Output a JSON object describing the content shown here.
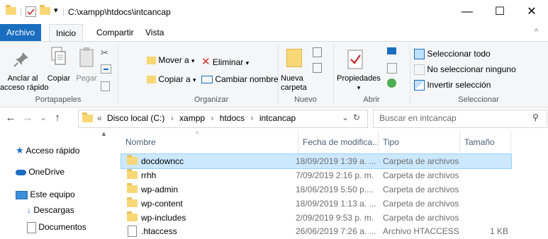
{
  "window": {
    "path_title": "C:\\xampp\\htdocs\\intcancap",
    "minimize_glyph": "—",
    "maximize_glyph": "☐",
    "close_glyph": "✕"
  },
  "ribbon_tabs": [
    "Archivo",
    "Inicio",
    "Compartir",
    "Vista"
  ],
  "ribbon_collapse_glyph": "^",
  "ribbon": {
    "portapapeles": {
      "label": "Portapapeles",
      "pin_label_1": "Anclar al",
      "pin_label_2": "acceso rápido",
      "copy_label": "Copiar",
      "paste_label": "Pegar"
    },
    "organizar": {
      "label": "Organizar",
      "move_to": "Mover a",
      "copy_to": "Copiar a",
      "delete": "Eliminar",
      "rename": "Cambiar nombre"
    },
    "nuevo": {
      "label": "Nuevo",
      "new_folder_1": "Nueva",
      "new_folder_2": "carpeta"
    },
    "abrir": {
      "label": "Abrir",
      "properties": "Propiedades"
    },
    "seleccionar": {
      "label": "Seleccionar",
      "select_all": "Seleccionar todo",
      "select_none": "No seleccionar ninguno",
      "invert": "Invertir selección"
    }
  },
  "address": {
    "prefix": "«",
    "crumbs": [
      "Disco local (C:)",
      "xampp",
      "htdocs",
      "intcancap"
    ],
    "separator": "›",
    "dropdown_glyph": "⌄",
    "refresh_glyph": "↻"
  },
  "search": {
    "placeholder": "Buscar en intcancap"
  },
  "nav_glyphs": {
    "back": "←",
    "forward": "→",
    "recent": "⌄",
    "up": "↑"
  },
  "nav_pane": {
    "items": [
      "Acceso rápido",
      "OneDrive",
      "Este equipo",
      "Descargas",
      "Documentos"
    ]
  },
  "columns": {
    "name": "Nombre",
    "date": "Fecha de modifica...",
    "type": "Tipo",
    "size": "Tamaño",
    "sort_glyph": "^"
  },
  "files": [
    {
      "name": "docdowncc",
      "date": "18/09/2019 1:39 a. ...",
      "type": "Carpeta de archivos",
      "size": "",
      "kind": "folder",
      "selected": true
    },
    {
      "name": "rrhh",
      "date": "7/09/2019 2:16 p. m.",
      "type": "Carpeta de archivos",
      "size": "",
      "kind": "folder"
    },
    {
      "name": "wp-admin",
      "date": "18/06/2019 5:50 p....",
      "type": "Carpeta de archivos",
      "size": "",
      "kind": "folder"
    },
    {
      "name": "wp-content",
      "date": "18/09/2019 1:13 a. ...",
      "type": "Carpeta de archivos",
      "size": "",
      "kind": "folder"
    },
    {
      "name": "wp-includes",
      "date": "2/09/2019 9:53 p. m.",
      "type": "Carpeta de archivos",
      "size": "",
      "kind": "folder"
    },
    {
      "name": ".htaccess",
      "date": "26/06/2019 7:26 a. ...",
      "type": "Archivo HTACCESS",
      "size": "1 KB",
      "kind": "file"
    }
  ],
  "colors": {
    "file_tab": "#1a6ec0",
    "selection": "#cce8ff",
    "folder": "#f8d775",
    "delete_x": "#d32f2f"
  }
}
